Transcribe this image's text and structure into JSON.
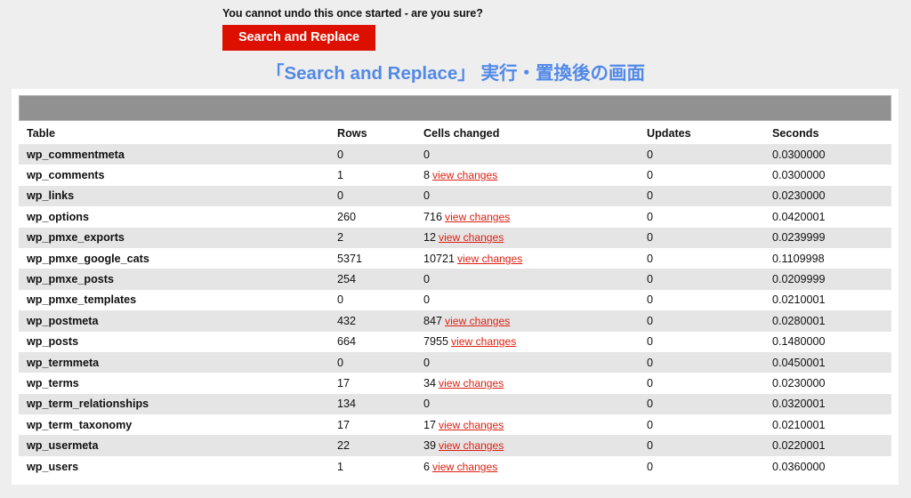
{
  "notice": {
    "warning_text": "You cannot undo this once started - are you sure?",
    "run_button_label": "Search and Replace"
  },
  "heading": {
    "title": "「Search and Replace」 実行・置換後の画面"
  },
  "colors": {
    "page_background": "#eeeeee",
    "card_background": "#ffffff",
    "button_red": "#dd1000",
    "heading_blue": "#5289e8",
    "link_red": "#dd1f11",
    "row_stripe": "#e5e5e5",
    "redacted_banner": "#919191"
  },
  "results_table": {
    "columns": [
      "Table",
      "Rows",
      "Cells changed",
      "Updates",
      "Seconds"
    ],
    "view_changes_label": "view changes",
    "rows": [
      {
        "table": "wp_commentmeta",
        "rows": "0",
        "cells": "0",
        "has_link": false,
        "updates": "0",
        "seconds": "0.0300000"
      },
      {
        "table": "wp_comments",
        "rows": "1",
        "cells": "8",
        "has_link": true,
        "updates": "0",
        "seconds": "0.0300000"
      },
      {
        "table": "wp_links",
        "rows": "0",
        "cells": "0",
        "has_link": false,
        "updates": "0",
        "seconds": "0.0230000"
      },
      {
        "table": "wp_options",
        "rows": "260",
        "cells": "716",
        "has_link": true,
        "updates": "0",
        "seconds": "0.0420001"
      },
      {
        "table": "wp_pmxe_exports",
        "rows": "2",
        "cells": "12",
        "has_link": true,
        "updates": "0",
        "seconds": "0.0239999"
      },
      {
        "table": "wp_pmxe_google_cats",
        "rows": "5371",
        "cells": "10721",
        "has_link": true,
        "updates": "0",
        "seconds": "0.1109998"
      },
      {
        "table": "wp_pmxe_posts",
        "rows": "254",
        "cells": "0",
        "has_link": false,
        "updates": "0",
        "seconds": "0.0209999"
      },
      {
        "table": "wp_pmxe_templates",
        "rows": "0",
        "cells": "0",
        "has_link": false,
        "updates": "0",
        "seconds": "0.0210001"
      },
      {
        "table": "wp_postmeta",
        "rows": "432",
        "cells": "847",
        "has_link": true,
        "updates": "0",
        "seconds": "0.0280001"
      },
      {
        "table": "wp_posts",
        "rows": "664",
        "cells": "7955",
        "has_link": true,
        "updates": "0",
        "seconds": "0.1480000"
      },
      {
        "table": "wp_termmeta",
        "rows": "0",
        "cells": "0",
        "has_link": false,
        "updates": "0",
        "seconds": "0.0450001"
      },
      {
        "table": "wp_terms",
        "rows": "17",
        "cells": "34",
        "has_link": true,
        "updates": "0",
        "seconds": "0.0230000"
      },
      {
        "table": "wp_term_relationships",
        "rows": "134",
        "cells": "0",
        "has_link": false,
        "updates": "0",
        "seconds": "0.0320001"
      },
      {
        "table": "wp_term_taxonomy",
        "rows": "17",
        "cells": "17",
        "has_link": true,
        "updates": "0",
        "seconds": "0.0210001"
      },
      {
        "table": "wp_usermeta",
        "rows": "22",
        "cells": "39",
        "has_link": true,
        "updates": "0",
        "seconds": "0.0220001"
      },
      {
        "table": "wp_users",
        "rows": "1",
        "cells": "6",
        "has_link": true,
        "updates": "0",
        "seconds": "0.0360000"
      }
    ]
  }
}
